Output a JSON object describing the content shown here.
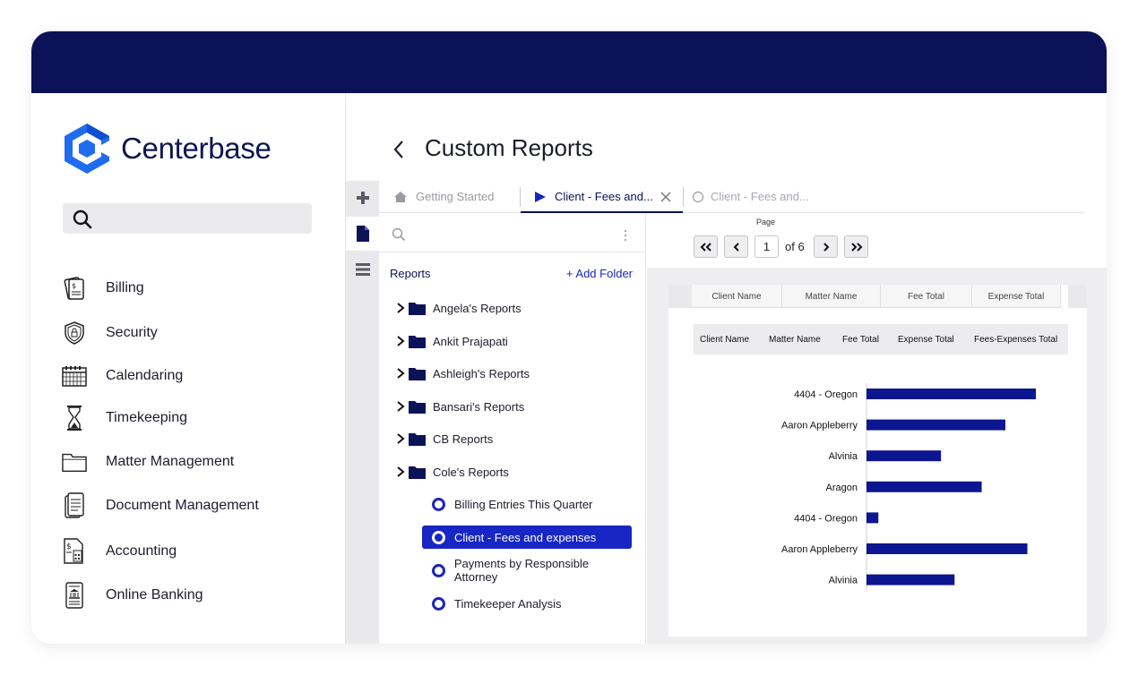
{
  "brand": {
    "name": "Centerbase",
    "logo_color": "#1f6cf0"
  },
  "sidebar": {
    "search_placeholder": "",
    "items": [
      {
        "label": "Billing",
        "icon": "billing-icon"
      },
      {
        "label": "Security",
        "icon": "shield-lock-icon"
      },
      {
        "label": "Calendaring",
        "icon": "calendar-icon"
      },
      {
        "label": "Timekeeping",
        "icon": "hourglass-icon"
      },
      {
        "label": "Matter Management",
        "icon": "folder-icon"
      },
      {
        "label": "Document Management",
        "icon": "document-icon"
      },
      {
        "label": "Accounting",
        "icon": "accounting-icon"
      },
      {
        "label": "Online Banking",
        "icon": "bank-icon"
      }
    ]
  },
  "main": {
    "title": "Custom Reports",
    "tabs": [
      {
        "label": "Getting Started",
        "state": "inactive",
        "icon": "home-icon"
      },
      {
        "label": "Client - Fees and...",
        "state": "active",
        "icon": "play-icon",
        "closable": true
      },
      {
        "label": "Client - Fees and...",
        "state": "inactive",
        "icon": "circle-icon"
      }
    ],
    "tree": {
      "header": "Reports",
      "add_folder": "+ Add Folder",
      "search_placeholder": "",
      "folders": [
        "Angela's Reports",
        "Ankit Prajapati",
        "Ashleigh's Reports",
        "Bansari's Reports",
        "CB Reports",
        "Cole's Reports"
      ],
      "reports": [
        {
          "label": "Billing Entries This Quarter",
          "selected": false
        },
        {
          "label": "Client - Fees and expenses",
          "selected": true
        },
        {
          "label": "Payments by Responsible Attorney",
          "selected": false
        },
        {
          "label": "Timekeeper Analysis",
          "selected": false
        }
      ]
    },
    "viewer": {
      "page_caption": "Page",
      "page_current": "1",
      "page_of": "of 6",
      "header_row_1": [
        "Client Name",
        "Matter Name",
        "Fee Total",
        "Expense Total"
      ],
      "header_row_2": [
        "Client Name",
        "Matter Name",
        "Fee Total",
        "Expense Total",
        "Fees-Expenses Total"
      ]
    }
  },
  "colors": {
    "navy": "#0b1257",
    "accent": "#1726c4",
    "bar": "#0c1690"
  },
  "chart_data": {
    "type": "bar",
    "orientation": "horizontal",
    "categories": [
      "4404 - Oregon",
      "Aaron Appleberry",
      "Alvinia",
      "Aragon",
      "4404 - Oregon",
      "Aaron Appleberry",
      "Alvinia"
    ],
    "values": [
      100,
      82,
      44,
      68,
      7,
      95,
      52
    ],
    "title": "",
    "xlabel": "",
    "ylabel": ""
  }
}
